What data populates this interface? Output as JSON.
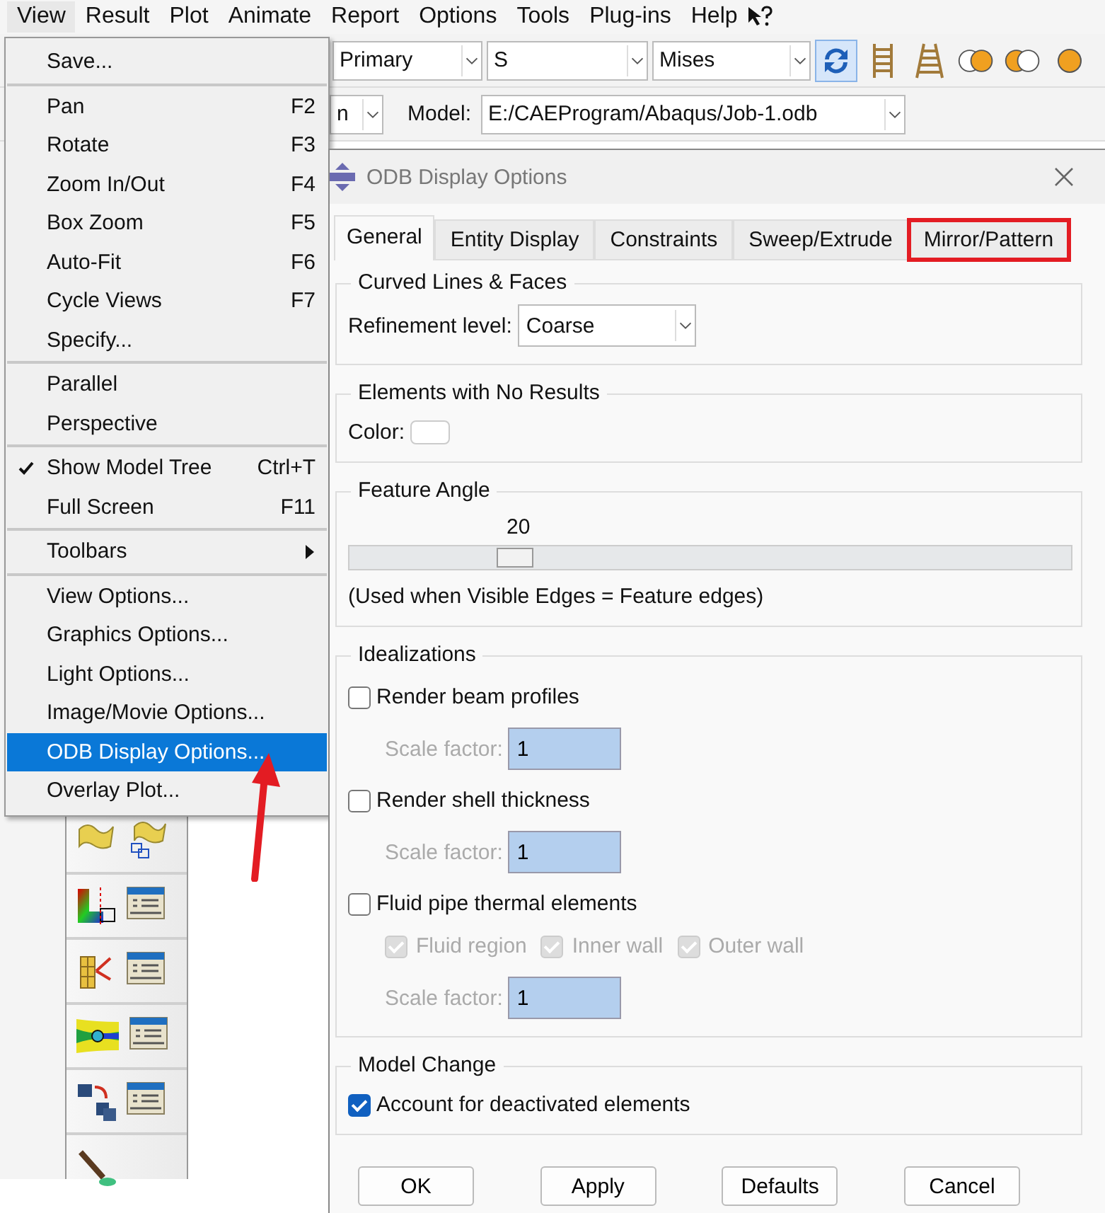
{
  "menubar": [
    {
      "label": "View",
      "selected": true
    },
    {
      "label": "Result",
      "selected": false
    },
    {
      "label": "Plot",
      "selected": false
    },
    {
      "label": "Animate",
      "selected": false
    },
    {
      "label": "Report",
      "selected": false
    },
    {
      "label": "Options",
      "selected": false
    },
    {
      "label": "Tools",
      "selected": false
    },
    {
      "label": "Plug-ins",
      "selected": false
    },
    {
      "label": "Help",
      "selected": false
    }
  ],
  "toolbar": {
    "combos": [
      "Primary",
      "S",
      "Mises"
    ],
    "row2_combo": "n",
    "model_label": "Model:",
    "model_value": "E:/CAEProgram/Abaqus/Job-1.odb"
  },
  "menu": {
    "groups": [
      {
        "items": [
          {
            "label": "Save...",
            "kind": "item",
            "checked": false,
            "selected": false
          }
        ]
      },
      {
        "items": [
          {
            "label": "Pan",
            "shortcut": "F2",
            "kind": "item",
            "checked": false,
            "selected": false
          },
          {
            "label": "Rotate",
            "shortcut": "F3",
            "kind": "item",
            "checked": false,
            "selected": false
          },
          {
            "label": "Zoom In/Out",
            "shortcut": "F4",
            "kind": "item",
            "checked": false,
            "selected": false
          },
          {
            "label": "Box Zoom",
            "shortcut": "F5",
            "kind": "item",
            "checked": false,
            "selected": false
          },
          {
            "label": "Auto-Fit",
            "shortcut": "F6",
            "kind": "item",
            "checked": false,
            "selected": false
          },
          {
            "label": "Cycle Views",
            "shortcut": "F7",
            "kind": "item",
            "checked": false,
            "selected": false
          },
          {
            "label": "Specify...",
            "kind": "item",
            "checked": false,
            "selected": false
          }
        ]
      },
      {
        "items": [
          {
            "label": "Parallel",
            "kind": "item",
            "checked": false,
            "selected": false
          },
          {
            "label": "Perspective",
            "kind": "item",
            "checked": false,
            "selected": false
          }
        ]
      },
      {
        "items": [
          {
            "label": "Show Model Tree",
            "shortcut": "Ctrl+T",
            "kind": "item",
            "checked": true,
            "selected": false
          },
          {
            "label": "Full Screen",
            "shortcut": "F11",
            "kind": "item",
            "checked": false,
            "selected": false
          }
        ]
      },
      {
        "items": [
          {
            "label": "Toolbars",
            "kind": "submenu",
            "checked": false,
            "selected": false
          }
        ]
      },
      {
        "items": [
          {
            "label": "View Options...",
            "kind": "item",
            "checked": false,
            "selected": false
          },
          {
            "label": "Graphics Options...",
            "kind": "item",
            "checked": false,
            "selected": false
          },
          {
            "label": "Light Options...",
            "kind": "item",
            "checked": false,
            "selected": false
          },
          {
            "label": "Image/Movie Options...",
            "kind": "item",
            "checked": false,
            "selected": false
          },
          {
            "label": "ODB Display Options...",
            "kind": "item",
            "checked": false,
            "selected": true
          },
          {
            "label": "Overlay Plot...",
            "kind": "item",
            "checked": false,
            "selected": false
          }
        ]
      }
    ]
  },
  "dialog": {
    "title": "ODB Display Options",
    "tabs": [
      {
        "label": "General",
        "selected": true,
        "highlighted": false
      },
      {
        "label": "Entity Display",
        "selected": false,
        "highlighted": false
      },
      {
        "label": "Constraints",
        "selected": false,
        "highlighted": false
      },
      {
        "label": "Sweep/Extrude",
        "selected": false,
        "highlighted": false
      },
      {
        "label": "Mirror/Pattern",
        "selected": false,
        "highlighted": true
      }
    ],
    "curved": {
      "title": "Curved Lines & Faces",
      "label": "Refinement level:",
      "value": "Coarse"
    },
    "no_results": {
      "title": "Elements with No Results",
      "label": "Color:",
      "color": "#ffffff"
    },
    "feature_angle": {
      "title": "Feature Angle",
      "reading": "20",
      "level": 0.22,
      "note": "(Used when Visible Edges = Feature edges)"
    },
    "idealizations": {
      "title": "Idealizations",
      "options": [
        {
          "label": "Render beam profiles",
          "checked": false,
          "scale_label": "Scale factor:",
          "scale_value": "1"
        },
        {
          "label": "Render shell thickness",
          "checked": false,
          "scale_label": "Scale factor:",
          "scale_value": "1"
        },
        {
          "label": "Fluid pipe thermal elements",
          "checked": false,
          "sub": [
            {
              "label": "Fluid region",
              "checked": true,
              "disabled": true
            },
            {
              "label": "Inner wall",
              "checked": true,
              "disabled": true
            },
            {
              "label": "Outer wall",
              "checked": true,
              "disabled": true
            }
          ],
          "scale_label": "Scale factor:",
          "scale_value": "1"
        }
      ]
    },
    "model_change": {
      "title": "Model Change",
      "option": {
        "label": "Account for deactivated elements",
        "checked": true
      }
    },
    "buttons": [
      "OK",
      "Apply",
      "Defaults",
      "Cancel"
    ]
  }
}
